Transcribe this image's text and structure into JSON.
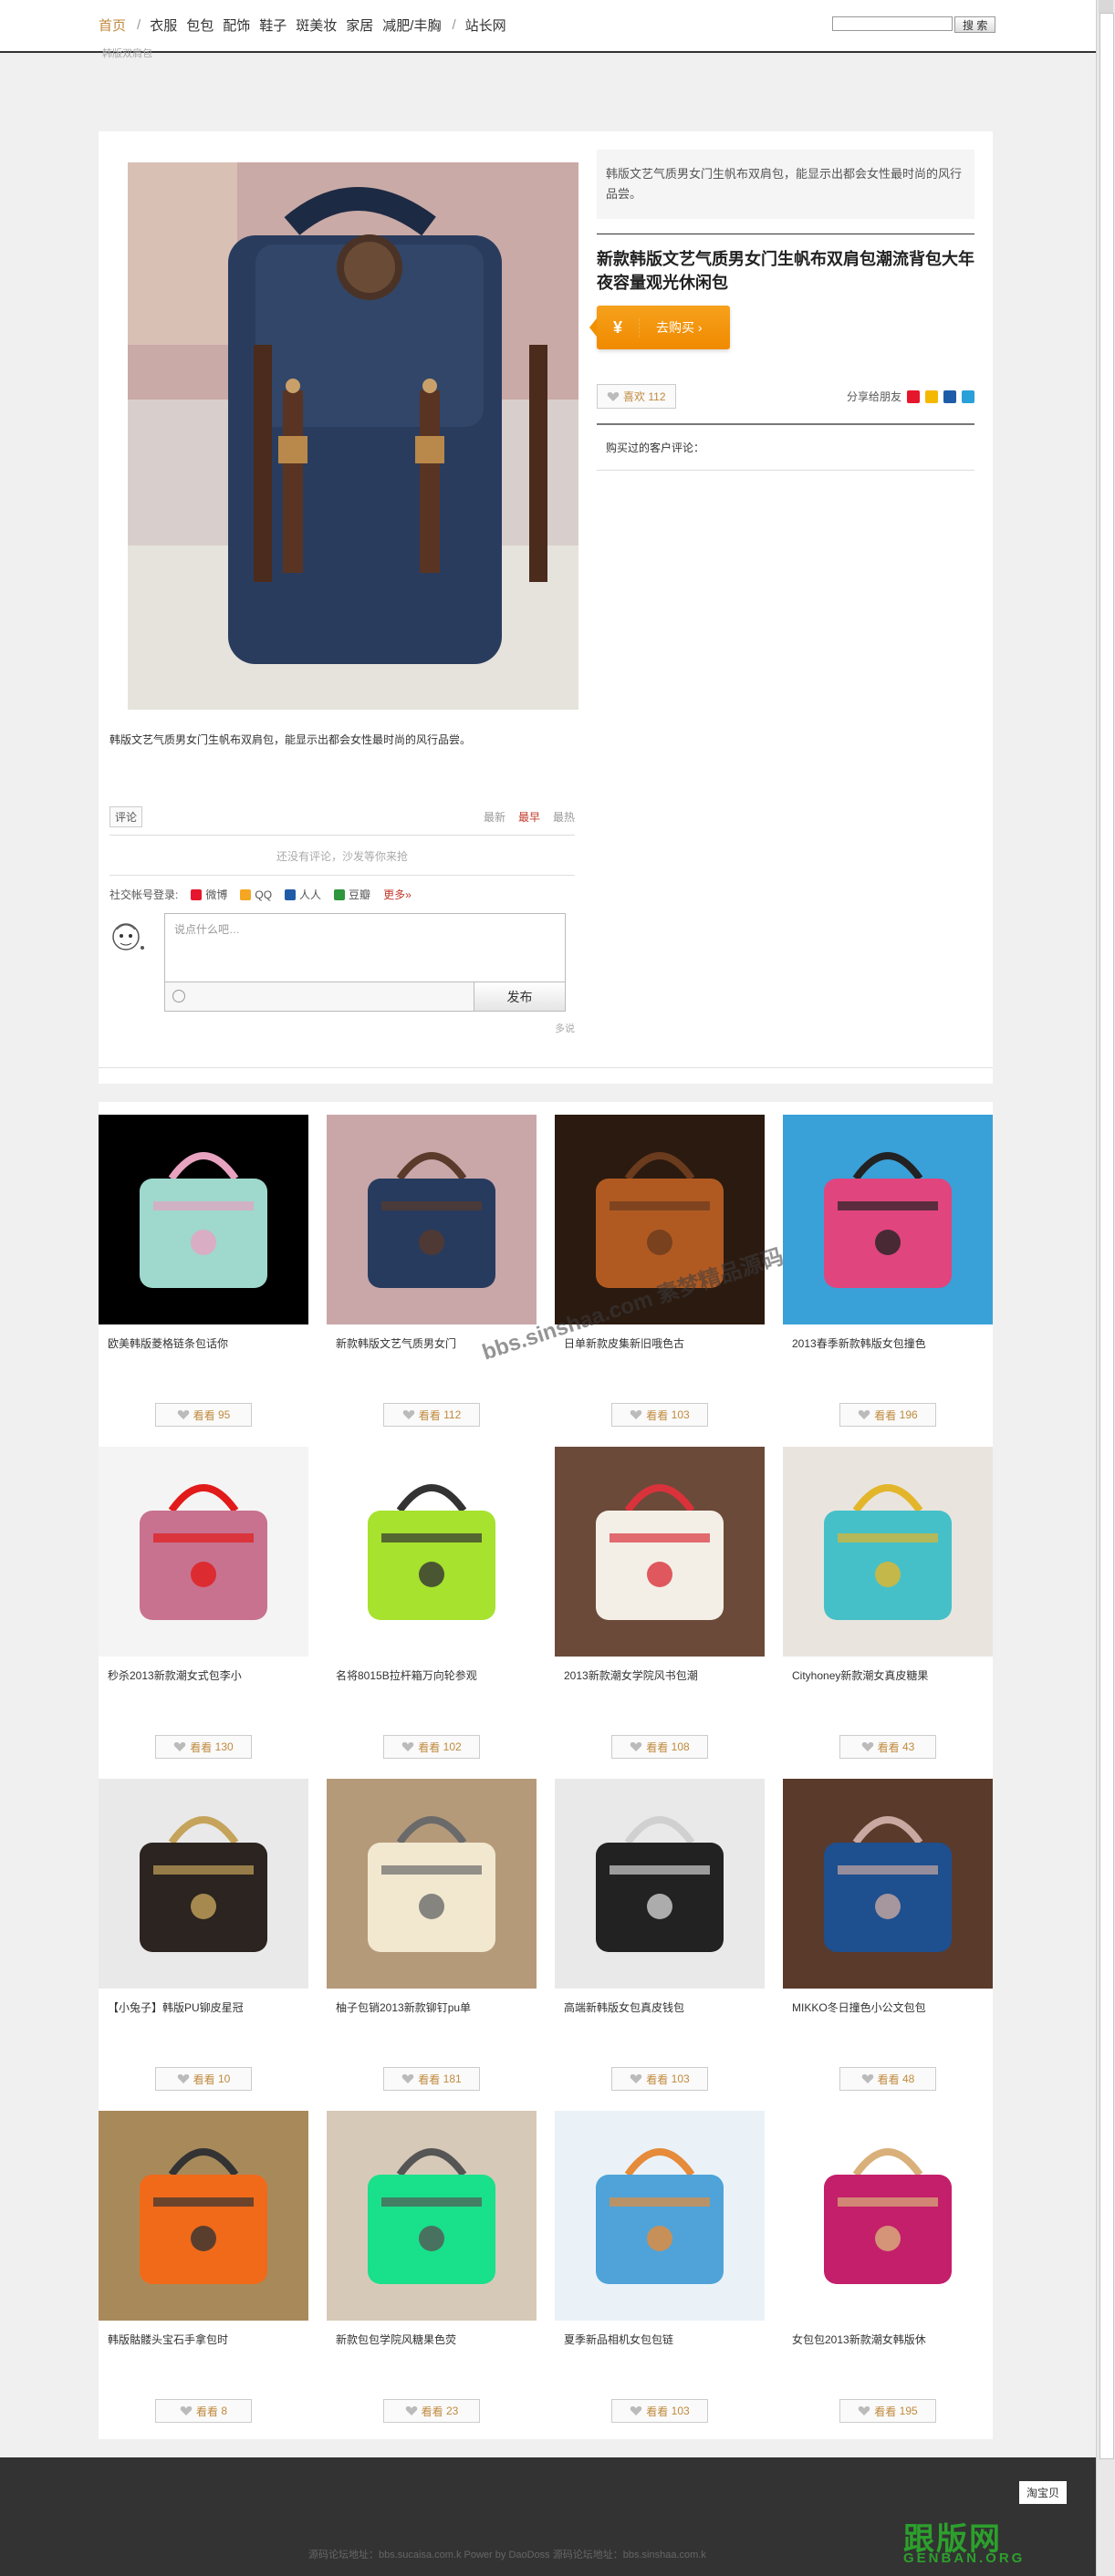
{
  "nav": {
    "items": [
      {
        "label": "首页",
        "active": true
      },
      {
        "label": "衣服"
      },
      {
        "label": "包包"
      },
      {
        "label": "配饰"
      },
      {
        "label": "鞋子"
      },
      {
        "label": "斑美妆"
      },
      {
        "label": "家居"
      },
      {
        "label": "减肥/丰胸"
      },
      {
        "label": "站长网"
      }
    ],
    "search_button": "搜 索",
    "search_value": ""
  },
  "breadcrumb": "韩版双肩包",
  "product": {
    "summary": "韩版文艺气质男女门生帆布双肩包，能显示出都会女性最时尚的风行品尝。",
    "title": "新款韩版文艺气质男女门生帆布双肩包潮流背包大年夜容量观光休闲包",
    "buy_symbol": "¥",
    "buy_label": "去购买 ›",
    "like_label": "喜欢",
    "like_count": "112",
    "share_label": "分享给朋友",
    "buyer_comments_label": "购买过的客户评论：",
    "description": "韩版文艺气质男女门生帆布双肩包，能显示出都会女性最时尚的风行品尝。"
  },
  "comments": {
    "tab_label": "评论",
    "sort": [
      {
        "label": "最新"
      },
      {
        "label": "最早",
        "active": true
      },
      {
        "label": "最热"
      }
    ],
    "empty": "还没有评论，沙发等你来抢",
    "social_label": "社交帐号登录:",
    "social": [
      {
        "label": "微博",
        "color": "#e6162d"
      },
      {
        "label": "QQ",
        "color": "#f5a623"
      },
      {
        "label": "人人",
        "color": "#1f5ca8"
      },
      {
        "label": "豆瓣",
        "color": "#2e963d"
      }
    ],
    "more": "更多»",
    "placeholder": "说点什么吧…",
    "post_button": "发布",
    "powered": "多说"
  },
  "products": [
    {
      "name": "欧美韩版菱格链条包话你",
      "label": "看看",
      "count": "95",
      "palette": [
        "#000000",
        "#9fd8cc",
        "#e7a3c0"
      ]
    },
    {
      "name": "新款韩版文艺气质男女门",
      "label": "看看",
      "count": "112",
      "palette": [
        "#c9a7a9",
        "#273b5e",
        "#5a3a2a"
      ]
    },
    {
      "name": "日单新款皮集新旧哦色古",
      "label": "看看",
      "count": "103",
      "palette": [
        "#2b1a10",
        "#b05a22",
        "#6b3b1e"
      ]
    },
    {
      "name": "2013春季新款韩版女包撞色",
      "label": "看看",
      "count": "196",
      "palette": [
        "#3aa0d8",
        "#e0457e",
        "#222222"
      ]
    },
    {
      "name": "秒杀2013新款潮女式包李小",
      "label": "看看",
      "count": "130",
      "palette": [
        "#f4f4f4",
        "#c8728f",
        "#e11a1a"
      ]
    },
    {
      "name": "名将8015B拉杆箱万向轮参观",
      "label": "看看",
      "count": "102",
      "palette": [
        "#ffffff",
        "#a6e22e",
        "#333333"
      ]
    },
    {
      "name": "2013新款潮女学院风书包潮",
      "label": "看看",
      "count": "108",
      "palette": [
        "#6b4a3a",
        "#f3efe6",
        "#d9323b"
      ]
    },
    {
      "name": "Cityhoney新款潮女真皮糖果",
      "label": "看看",
      "count": "43",
      "palette": [
        "#e9e5de",
        "#45c0c8",
        "#e3b52b"
      ]
    },
    {
      "name": "【小兔子】韩版PU铆皮星冠",
      "label": "看看",
      "count": "10",
      "palette": [
        "#e9e9e9",
        "#2b2420",
        "#c5a35b"
      ]
    },
    {
      "name": "柚子包销2013新款铆钉pu单",
      "label": "看看",
      "count": "181",
      "palette": [
        "#b59a7a",
        "#f1e8cf",
        "#6a6a6a"
      ]
    },
    {
      "name": "高端新韩版女包真皮钱包",
      "label": "看看",
      "count": "103",
      "palette": [
        "#e9e9e9",
        "#222222",
        "#d0d0d0"
      ]
    },
    {
      "name": "MIKKO冬日撞色小公文包包",
      "label": "看看",
      "count": "48",
      "palette": [
        "#5a3a2a",
        "#1e4f8f",
        "#c8a8a0"
      ]
    },
    {
      "name": "韩版骷髅头宝石手拿包时",
      "label": "看看",
      "count": "8",
      "palette": [
        "#a88a5a",
        "#f06a1a",
        "#333333"
      ]
    },
    {
      "name": "新款包包学院风糖果色荧",
      "label": "看看",
      "count": "23",
      "palette": [
        "#d7c9b8",
        "#19e08a",
        "#555555"
      ]
    },
    {
      "name": "夏季新品相机女包包链",
      "label": "看看",
      "count": "103",
      "palette": [
        "#eaf2f8",
        "#4fa3d8",
        "#e58b3a"
      ]
    },
    {
      "name": "女包包2013新款潮女韩版休",
      "label": "看看",
      "count": "195",
      "palette": [
        "#ffffff",
        "#c41f6a",
        "#d9b07a"
      ]
    }
  ],
  "watermark": "bbs.sinshaa.com 素梦精品源码",
  "footer": {
    "taobao": "淘宝贝",
    "text": "源码论坛地址：bbs.sucaisa.com.k   Power by DaoDoss   源码论坛地址：bbs.sinshaa.com.k",
    "brand": "跟版网",
    "brand_sub": "GENBAN.ORG"
  }
}
